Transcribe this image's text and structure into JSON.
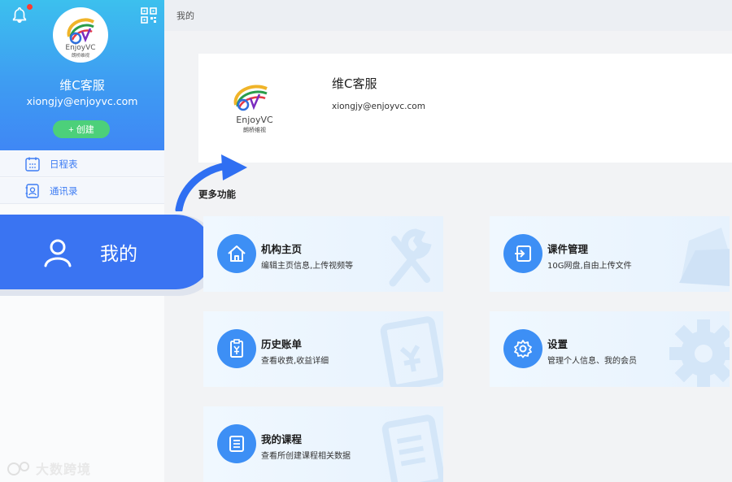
{
  "sidebar": {
    "user_name": "维C客服",
    "user_email": "xiongjy@enjoyvc.com",
    "create_label": "+ 创建",
    "items": [
      {
        "label": "日程表",
        "icon": "calendar-icon"
      },
      {
        "label": "通讯录",
        "icon": "contacts-icon"
      }
    ],
    "active_tab": {
      "label": "我的",
      "icon": "user-icon"
    },
    "watermark": "大数跨境"
  },
  "header": {
    "breadcrumb": "我的"
  },
  "profile": {
    "name": "维C客服",
    "email": "xiongjy@enjoyvc.com",
    "logo_text": "EnjoyVC",
    "logo_subtext": "朗桥维视"
  },
  "more": {
    "title": "更多功能",
    "cards": [
      {
        "title": "机构主页",
        "subtitle": "编辑主页信息,上传视频等",
        "icon": "home-icon"
      },
      {
        "title": "课件管理",
        "subtitle": "10G网盘,自由上传文件",
        "icon": "upload-icon"
      },
      {
        "title": "历史账单",
        "subtitle": "查看收费,收益详细",
        "icon": "bill-icon"
      },
      {
        "title": "设置",
        "subtitle": "管理个人信息、我的会员",
        "icon": "gear-icon"
      },
      {
        "title": "我的课程",
        "subtitle": "查看所创建课程相关数据",
        "icon": "course-icon"
      }
    ]
  },
  "colors": {
    "accent": "#3a74f2",
    "create_green": "#4cd07a",
    "header_top": "#3cc0ee",
    "header_bottom": "#3f87f5"
  }
}
